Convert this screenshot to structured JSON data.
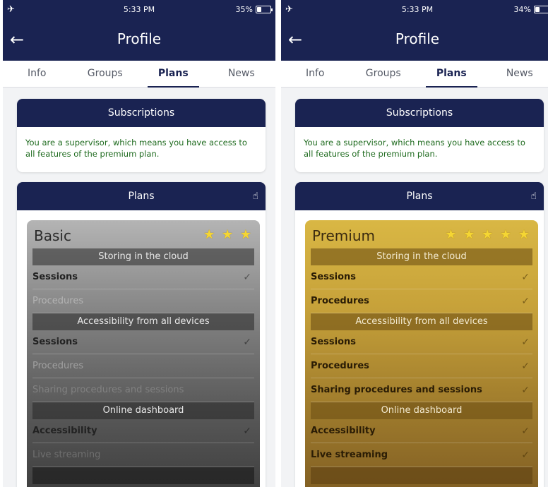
{
  "colors": {
    "navy": "#1a2352",
    "supervisor_text": "#1f6b1f",
    "star": "#f5d633"
  },
  "left": {
    "status": {
      "time": "5:33 PM",
      "battery": "35%",
      "battery_fraction": 0.35
    },
    "nav": {
      "back_icon": "arrow-left-icon",
      "title": "Profile"
    },
    "tabs": [
      {
        "label": "Info"
      },
      {
        "label": "Groups"
      },
      {
        "label": "Plans",
        "active": true
      },
      {
        "label": "News"
      }
    ],
    "subscriptions": {
      "title": "Subscriptions",
      "message": "You are a supervisor, which means you have access to all features of the premium plan."
    },
    "plans": {
      "title": "Plans",
      "gesture_icon": "swipe-hand-icon",
      "plan": {
        "name": "Basic",
        "stars": "★ ★ ★",
        "sections": [
          {
            "header": "Storing in the cloud"
          },
          {
            "header": "Accessibility from all devices"
          },
          {
            "header": "Online dashboard"
          }
        ],
        "rows": [
          {
            "label": "Sessions",
            "included": true
          },
          {
            "label": "Procedures",
            "included": false
          },
          {
            "label": "Sessions",
            "included": true
          },
          {
            "label": "Procedures",
            "included": false
          },
          {
            "label": "Sharing procedures and sessions",
            "included": false
          },
          {
            "label": "Accessibility",
            "included": true
          },
          {
            "label": "Live streaming",
            "included": false
          }
        ],
        "check": "✓"
      }
    }
  },
  "right": {
    "status": {
      "time": "5:33 PM",
      "battery": "34%",
      "battery_fraction": 0.34
    },
    "nav": {
      "back_icon": "arrow-left-icon",
      "title": "Profile"
    },
    "tabs": [
      {
        "label": "Info"
      },
      {
        "label": "Groups"
      },
      {
        "label": "Plans",
        "active": true
      },
      {
        "label": "News"
      }
    ],
    "subscriptions": {
      "title": "Subscriptions",
      "message": "You are a supervisor, which means you have access to all features of the premium plan."
    },
    "plans": {
      "title": "Plans",
      "gesture_icon": "swipe-hand-icon",
      "plan": {
        "name": "Premium",
        "stars": "★ ★ ★ ★ ★",
        "sections": [
          {
            "header": "Storing in the cloud"
          },
          {
            "header": "Accessibility from all devices"
          },
          {
            "header": "Online dashboard"
          }
        ],
        "rows": [
          {
            "label": "Sessions",
            "included": true
          },
          {
            "label": "Procedures",
            "included": true
          },
          {
            "label": "Sessions",
            "included": true
          },
          {
            "label": "Procedures",
            "included": true
          },
          {
            "label": "Sharing procedures and sessions",
            "included": true
          },
          {
            "label": "Accessibility",
            "included": true
          },
          {
            "label": "Live streaming",
            "included": true
          }
        ],
        "check": "✓"
      }
    }
  }
}
